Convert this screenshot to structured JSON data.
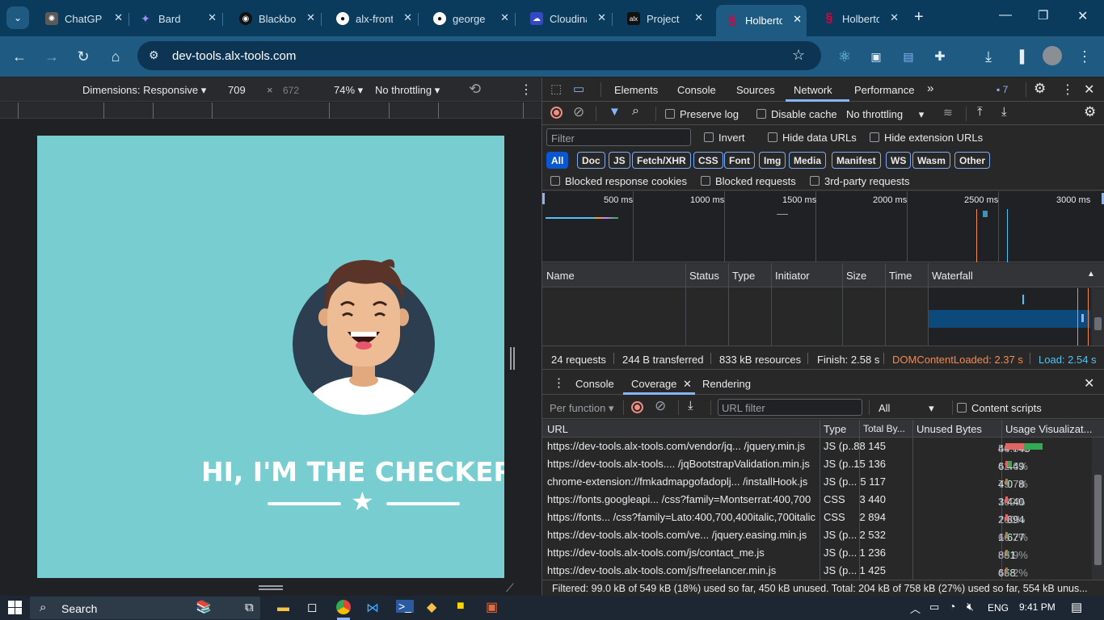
{
  "tabs": [
    {
      "title": "ChatGPT",
      "icon": "chatgpt-icon",
      "color": "#5a5a5a"
    },
    {
      "title": "Bard",
      "icon": "bard-icon",
      "color": "#4b6bd6"
    },
    {
      "title": "Blackbox",
      "icon": "blackbox-icon",
      "color": "#111111"
    },
    {
      "title": "alx-front",
      "icon": "github-icon",
      "color": "#111111"
    },
    {
      "title": "george",
      "icon": "github-icon",
      "color": "#111111"
    },
    {
      "title": "Cloudinary",
      "icon": "cloudinary-icon",
      "color": "#3448c5"
    },
    {
      "title": "Project",
      "icon": "alx-icon",
      "color": "#111111"
    },
    {
      "title": "Holberton",
      "icon": "holberton-icon",
      "color": "#e0003c"
    },
    {
      "title": "Holberton",
      "icon": "holberton-icon",
      "color": "#e0003c"
    }
  ],
  "address": {
    "url": "dev-tools.alx-tools.com"
  },
  "device_toolbar": {
    "dimensions_label": "Dimensions: Responsive",
    "width": "709",
    "times": "×",
    "height": "672",
    "zoom": "74%",
    "throttling": "No throttling"
  },
  "site": {
    "hero_text": "HI, I'M THE CHECKER"
  },
  "devtools": {
    "tabs": [
      "Elements",
      "Console",
      "Sources",
      "Network",
      "Performance"
    ],
    "active_tab": "Network",
    "issues_count": "7",
    "preserve_log": "Preserve log",
    "disable_cache": "Disable cache",
    "throttling": "No throttling",
    "filter_placeholder": "Filter",
    "invert": "Invert",
    "hide_data_urls": "Hide data URLs",
    "hide_extension_urls": "Hide extension URLs",
    "type_filters": [
      "All",
      "Doc",
      "JS",
      "Fetch/XHR",
      "CSS",
      "Font",
      "Img",
      "Media",
      "Manifest",
      "WS",
      "Wasm",
      "Other"
    ],
    "blocked_cookies": "Blocked response cookies",
    "blocked_requests": "Blocked requests",
    "third_party": "3rd-party requests",
    "timeline_ticks": [
      "500 ms",
      "1000 ms",
      "1500 ms",
      "2000 ms",
      "2500 ms",
      "3000 ms"
    ],
    "columns": [
      "Name",
      "Status",
      "Type",
      "Initiator",
      "Size",
      "Time",
      "Waterfall"
    ],
    "summary": {
      "requests": "24 requests",
      "transferred": "244 B transferred",
      "resources": "833 kB resources",
      "finish": "Finish: 2.58 s",
      "dcl": "DOMContentLoaded: 2.37 s",
      "load": "Load: 2.54 s"
    }
  },
  "drawer": {
    "tabs": [
      "Console",
      "Coverage",
      "Rendering"
    ],
    "active_tab": "Coverage",
    "per_function": "Per function",
    "url_filter_placeholder": "URL filter",
    "type_select": "All",
    "content_scripts": "Content scripts",
    "columns": [
      "URL",
      "Type",
      "Total By...",
      "Unused Bytes",
      "Usage Visualizat..."
    ],
    "rows": [
      {
        "url": "https://dev-tools.alx-tools.com/vendor/jq...  /jquery.min.js",
        "type": "JS (p...",
        "total": "88 145",
        "unused": "44 745",
        "pct": "50.8%",
        "used_frac": 0.492
      },
      {
        "url": "https://dev-tools.alx-tools.... /jqBootstrapValidation.min.js",
        "type": "JS (p...",
        "total": "15 136",
        "unused": "6 449",
        "pct": "42.6%",
        "used_frac": 0.574
      },
      {
        "url": "chrome-extension://fmkadmapgofadoplj...  /installHook.js",
        "type": "JS (p...",
        "total": "5 117",
        "unused": "4 078",
        "pct": "79.7%",
        "used_frac": 0.203
      },
      {
        "url": "https://fonts.googleapi...  /css?family=Montserrat:400,700",
        "type": "CSS",
        "total": "3 440",
        "unused": "3 440",
        "pct": "100%",
        "used_frac": 0.0
      },
      {
        "url": "https://fonts... /css?family=Lato:400,700,400italic,700italic",
        "type": "CSS",
        "total": "2 894",
        "unused": "2 894",
        "pct": "100%",
        "used_frac": 0.0
      },
      {
        "url": "https://dev-tools.alx-tools.com/ve...  /jquery.easing.min.js",
        "type": "JS (p...",
        "total": "2 532",
        "unused": "1 677",
        "pct": "66.2%",
        "used_frac": 0.338
      },
      {
        "url": "https://dev-tools.alx-tools.com/js/contact_me.js",
        "type": "JS (p...",
        "total": "1 236",
        "unused": "851",
        "pct": "68.9%",
        "used_frac": 0.311
      },
      {
        "url": "https://dev-tools.alx-tools.com/js/freelancer.min.js",
        "type": "JS (p...",
        "total": "1 425",
        "unused": "658",
        "pct": "46.2%",
        "used_frac": 0.538
      }
    ],
    "footer": "Filtered: 99.0 kB of 549 kB (18%) used so far, 450 kB unused. Total: 204 kB of 758 kB (27%) used so far, 554 kB unus..."
  },
  "taskbar": {
    "search": "Search",
    "lang": "ENG",
    "time": "9:41 PM"
  },
  "colors": {
    "tabstrip": "#0a3a5c",
    "toolbar": "#1e5a82",
    "site_bg": "#78cdd1",
    "dcl": "#f28b54",
    "load": "#4fc3f7",
    "used": "#34a853",
    "unused": "#e06666"
  }
}
